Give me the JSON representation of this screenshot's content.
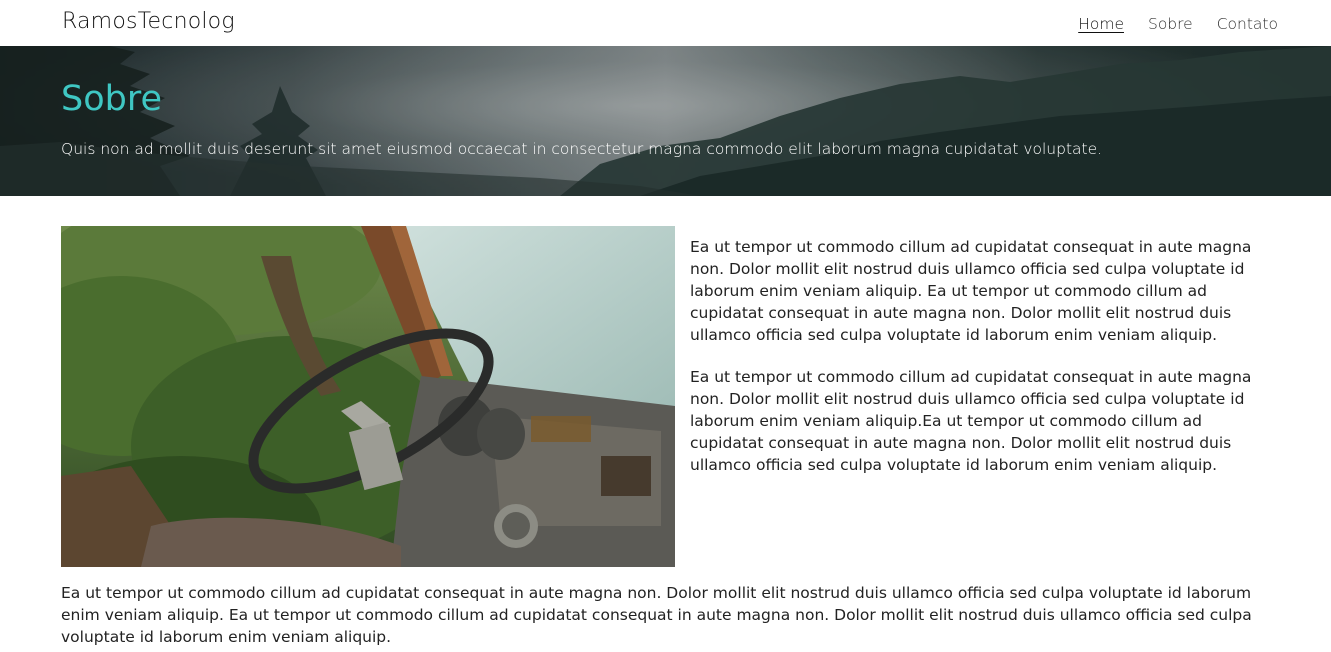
{
  "nav": {
    "brand": "RamosTecnolog",
    "links": [
      {
        "label": "Home",
        "active": true
      },
      {
        "label": "Sobre",
        "active": false
      },
      {
        "label": "Contato",
        "active": false
      }
    ]
  },
  "hero": {
    "title": "Sobre",
    "subtitle": "Quis non ad mollit duis deserunt sit amet eiusmod occaecat in consectetur magna commodo elit laborum magna cupidatat voluptate.",
    "title_color": "#3fc7c3"
  },
  "content": {
    "paragraphs": [
      "Ea ut tempor ut commodo cillum ad cupidatat consequat in aute magna non. Dolor mollit elit nostrud duis ullamco officia sed culpa voluptate id laborum enim veniam aliquip. Ea ut tempor ut commodo cillum ad cupidatat consequat in aute magna non. Dolor mollit elit nostrud duis ullamco officia sed culpa voluptate id laborum enim veniam aliquip.",
      "Ea ut tempor ut commodo cillum ad cupidatat consequat in aute magna non. Dolor mollit elit nostrud duis ullamco officia sed culpa voluptate id laborum enim veniam aliquip.Ea ut tempor ut commodo cillum ad cupidatat consequat in aute magna non. Dolor mollit elit nostrud duis ullamco officia sed culpa voluptate id laborum enim veniam aliquip."
    ],
    "bottom_paragraph": "Ea ut tempor ut commodo cillum ad cupidatat consequat in aute magna non. Dolor mollit elit nostrud duis ullamco officia sed culpa voluptate id laborum enim veniam aliquip. Ea ut tempor ut commodo cillum ad cupidatat consequat in aute magna non. Dolor mollit elit nostrud duis ullamco officia sed culpa voluptate id laborum enim veniam aliquip."
  }
}
